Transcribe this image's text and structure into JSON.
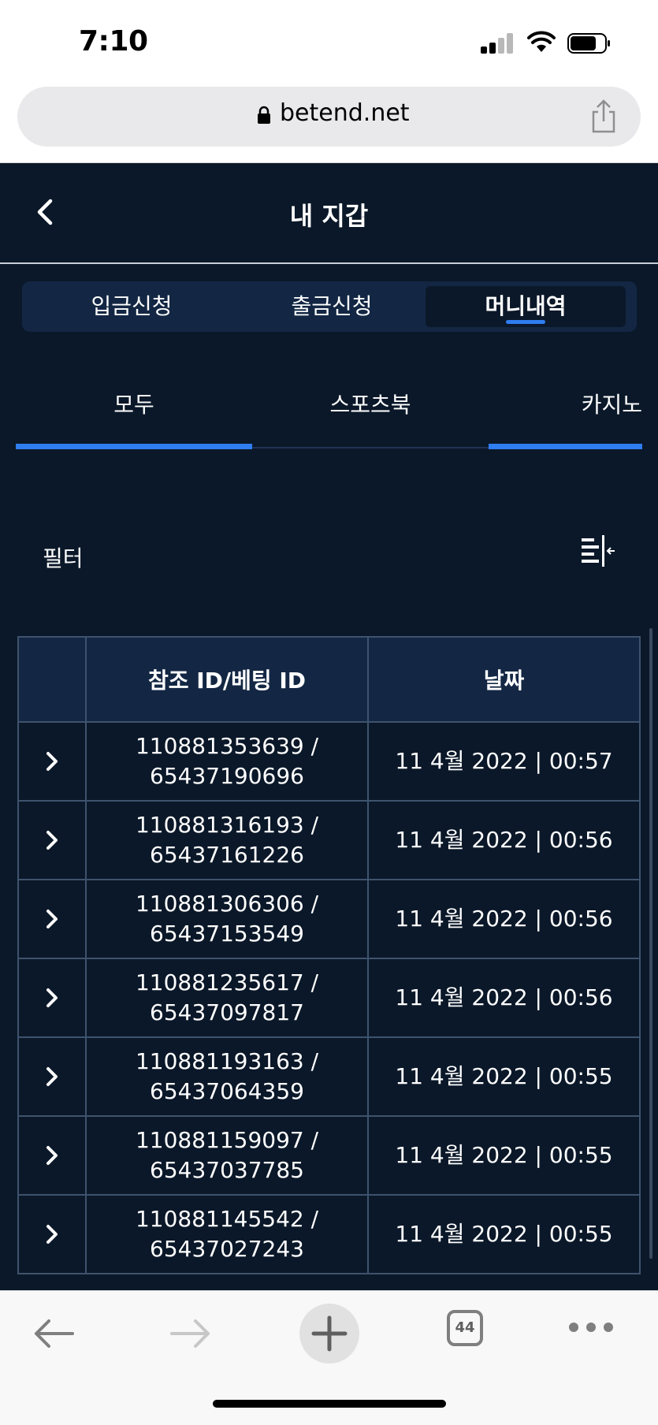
{
  "status": {
    "time": "7:10"
  },
  "browser": {
    "host": "betend.net",
    "tab_count": "44"
  },
  "header": {
    "title": "내 지갑"
  },
  "segments": [
    {
      "label": "입금신청"
    },
    {
      "label": "출금신청"
    },
    {
      "label": "머니내역",
      "active": true
    }
  ],
  "tabs": [
    {
      "label": "모두",
      "active": true
    },
    {
      "label": "스포츠북"
    },
    {
      "label": "카지노"
    }
  ],
  "filter": {
    "label": "필터"
  },
  "table": {
    "columns": [
      "",
      "참조 ID/베팅 ID",
      "날짜"
    ],
    "rows": [
      {
        "ref_id": "110881353639 /",
        "bet_id": "65437190696",
        "date": "11 4월 2022 | 00:57"
      },
      {
        "ref_id": "110881316193 /",
        "bet_id": "65437161226",
        "date": "11 4월 2022 | 00:56"
      },
      {
        "ref_id": "110881306306 /",
        "bet_id": "65437153549",
        "date": "11 4월 2022 | 00:56"
      },
      {
        "ref_id": "110881235617 /",
        "bet_id": "65437097817",
        "date": "11 4월 2022 | 00:56"
      },
      {
        "ref_id": "110881193163 /",
        "bet_id": "65437064359",
        "date": "11 4월 2022 | 00:55"
      },
      {
        "ref_id": "110881159097 /",
        "bet_id": "65437037785",
        "date": "11 4월 2022 | 00:55"
      },
      {
        "ref_id": "110881145542 /",
        "bet_id": "65437027243",
        "date": "11 4월 2022 | 00:55"
      }
    ]
  },
  "colors": {
    "background": "#0b1829",
    "panel": "#132744",
    "accent": "#2f7df0",
    "grid_border": "#3e536d"
  },
  "icons": [
    "signal-icon",
    "wifi-icon",
    "battery-icon",
    "lock-icon",
    "share-icon",
    "back-chevron-icon",
    "filter-sort-icon",
    "row-expand-chevron-icon",
    "back-arrow-icon",
    "forward-arrow-icon",
    "plus-icon",
    "tabs-icon",
    "more-icon"
  ]
}
